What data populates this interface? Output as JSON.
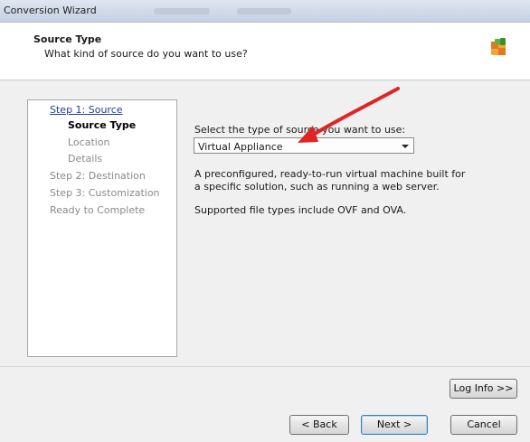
{
  "window": {
    "title": "Conversion Wizard"
  },
  "header": {
    "title": "Source Type",
    "subtitle": "What kind of source do you want to use?",
    "logo_icon": "vmware-converter-logo-icon"
  },
  "steps": [
    {
      "label": "Step 1: Source",
      "state": "link"
    },
    {
      "label": "Source Type",
      "state": "current"
    },
    {
      "label": "Location",
      "state": "pending"
    },
    {
      "label": "Details",
      "state": "pending"
    },
    {
      "label": "Step 2: Destination",
      "state": "pending"
    },
    {
      "label": "Step 3: Customization",
      "state": "pending"
    },
    {
      "label": "Ready to Complete",
      "state": "pending"
    }
  ],
  "main": {
    "select_label": "Select the type of source you want to use:",
    "source_type": {
      "selected": "Virtual Appliance",
      "icon": "chevron-down-icon"
    },
    "description": "A preconfigured, ready-to-run virtual machine built for a specific solution, such as running a web server.",
    "supported": "Supported file types include OVF and OVA."
  },
  "annotation": {
    "arrow_color": "#e02424"
  },
  "buttons": {
    "log_info": "Log Info >>",
    "back": "< Back",
    "next": "Next >",
    "cancel": "Cancel"
  },
  "colors": {
    "titlebar": "#cfdbe9",
    "link": "#1f3fa0",
    "disabled_text": "#8a8a8a",
    "default_button_border": "#3c7fb1"
  }
}
